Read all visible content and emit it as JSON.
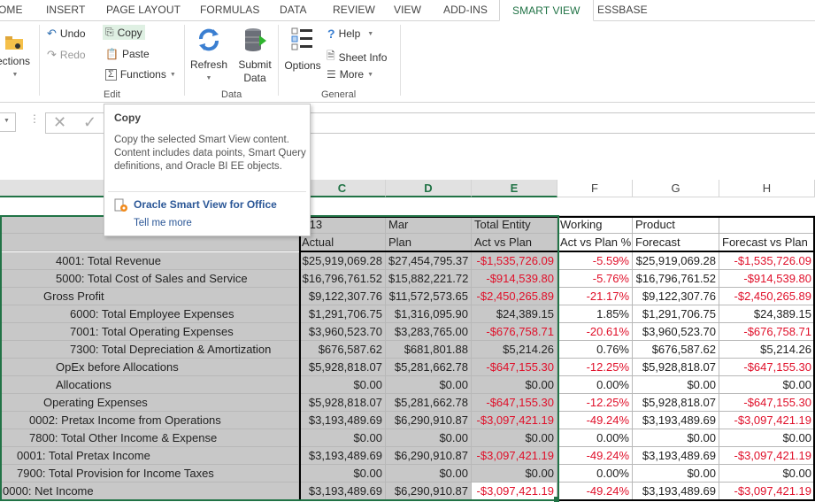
{
  "ribbon_tabs": [
    {
      "label": "OME",
      "active": false
    },
    {
      "label": "INSERT",
      "active": false
    },
    {
      "label": "PAGE LAYOUT",
      "active": false
    },
    {
      "label": "FORMULAS",
      "active": false
    },
    {
      "label": "DATA",
      "active": false
    },
    {
      "label": "REVIEW",
      "active": false
    },
    {
      "label": "VIEW",
      "active": false
    },
    {
      "label": "ADD-INS",
      "active": false
    },
    {
      "label": "SMART VIEW",
      "active": true
    },
    {
      "label": "ESSBASE",
      "active": false
    }
  ],
  "ribbon": {
    "connections_label": "ections",
    "edit": {
      "undo": "Undo",
      "redo": "Redo",
      "copy": "Copy",
      "paste": "Paste",
      "functions": "Functions",
      "group": "Edit"
    },
    "data": {
      "refresh": "Refresh",
      "submit_line1": "Submit",
      "submit_line2": "Data",
      "group": "Data"
    },
    "general": {
      "options": "Options",
      "help": "Help",
      "sheet_info": "Sheet Info",
      "more": "More",
      "group": "General"
    }
  },
  "tooltip": {
    "title": "Copy",
    "description": "Copy the selected Smart View content. Content includes data points, Smart Query definitions, and Oracle BI EE objects.",
    "link": "Oracle Smart View for Office",
    "tell_me_more": "Tell me more"
  },
  "column_headers": [
    "C",
    "D",
    "E",
    "F",
    "G",
    "H"
  ],
  "header_rows": [
    [
      "",
      "Y13",
      "Mar",
      "Total Entity",
      "Working",
      "Product",
      ""
    ],
    [
      "",
      "Actual",
      "Plan",
      "Act vs Plan",
      "Act vs Plan %",
      "Forecast",
      "Forecast vs Plan"
    ]
  ],
  "rows": [
    {
      "label": "4001: Total Revenue",
      "c": "$25,919,069.28",
      "d": "$27,454,795.37",
      "e": "-$1,535,726.09",
      "f": "-5.59%",
      "g": "$25,919,069.28",
      "h": "-$1,535,726.09"
    },
    {
      "label": "5000: Total Cost of Sales and Service",
      "c": "$16,796,761.52",
      "d": "$15,882,221.72",
      "e": "-$914,539.80",
      "f": "-5.76%",
      "g": "$16,796,761.52",
      "h": "-$914,539.80"
    },
    {
      "label": "Gross Profit",
      "c": "$9,122,307.76",
      "d": "$11,572,573.65",
      "e": "-$2,450,265.89",
      "f": "-21.17%",
      "g": "$9,122,307.76",
      "h": "-$2,450,265.89"
    },
    {
      "label": "6000: Total Employee Expenses",
      "c": "$1,291,706.75",
      "d": "$1,316,095.90",
      "e": "$24,389.15",
      "f": "1.85%",
      "g": "$1,291,706.75",
      "h": "$24,389.15"
    },
    {
      "label": "7001: Total Operating Expenses",
      "c": "$3,960,523.70",
      "d": "$3,283,765.00",
      "e": "-$676,758.71",
      "f": "-20.61%",
      "g": "$3,960,523.70",
      "h": "-$676,758.71"
    },
    {
      "label": "7300: Total Depreciation & Amortization",
      "c": "$676,587.62",
      "d": "$681,801.88",
      "e": "$5,214.26",
      "f": "0.76%",
      "g": "$676,587.62",
      "h": "$5,214.26"
    },
    {
      "label": "OpEx before Allocations",
      "c": "$5,928,818.07",
      "d": "$5,281,662.78",
      "e": "-$647,155.30",
      "f": "-12.25%",
      "g": "$5,928,818.07",
      "h": "-$647,155.30"
    },
    {
      "label": "Allocations",
      "c": "$0.00",
      "d": "$0.00",
      "e": "$0.00",
      "f": "0.00%",
      "g": "$0.00",
      "h": "$0.00"
    },
    {
      "label": "Operating Expenses",
      "c": "$5,928,818.07",
      "d": "$5,281,662.78",
      "e": "-$647,155.30",
      "f": "-12.25%",
      "g": "$5,928,818.07",
      "h": "-$647,155.30"
    },
    {
      "label": "0002: Pretax Income from Operations",
      "c": "$3,193,489.69",
      "d": "$6,290,910.87",
      "e": "-$3,097,421.19",
      "f": "-49.24%",
      "g": "$3,193,489.69",
      "h": "-$3,097,421.19"
    },
    {
      "label": "7800: Total Other Income & Expense",
      "c": "$0.00",
      "d": "$0.00",
      "e": "$0.00",
      "f": "0.00%",
      "g": "$0.00",
      "h": "$0.00"
    },
    {
      "label": "0001: Total Pretax Income",
      "c": "$3,193,489.69",
      "d": "$6,290,910.87",
      "e": "-$3,097,421.19",
      "f": "-49.24%",
      "g": "$3,193,489.69",
      "h": "-$3,097,421.19"
    },
    {
      "label": "7900: Total Provision for Income Taxes",
      "c": "$0.00",
      "d": "$0.00",
      "e": "$0.00",
      "f": "0.00%",
      "g": "$0.00",
      "h": "$0.00"
    },
    {
      "label": "0000: Net Income",
      "c": "$3,193,489.69",
      "d": "$6,290,910.87",
      "e": "-$3,097,421.19",
      "f": "-49.24%",
      "g": "$3,193,489.69",
      "h": "-$3,097,421.19"
    }
  ],
  "colors": {
    "accent": "#217346",
    "negative": "#e0102a",
    "selection_fill": "#c8c8c8",
    "link": "#2b5797"
  }
}
